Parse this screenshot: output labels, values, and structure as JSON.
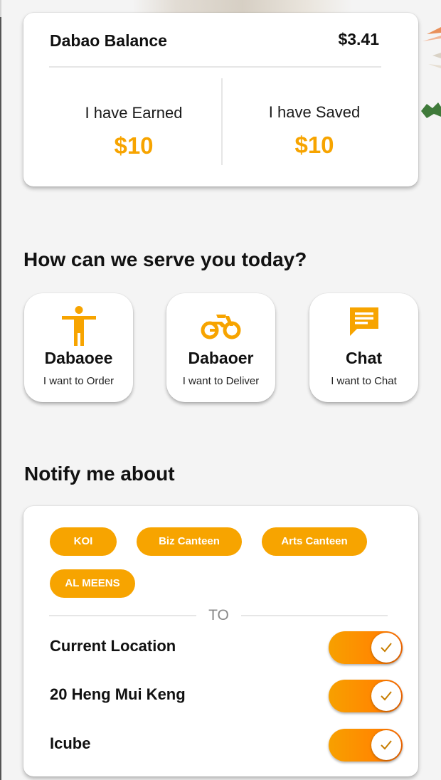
{
  "balance": {
    "label": "Dabao Balance",
    "value": "$3.41",
    "earned_label": "I have Earned",
    "earned_value": "$10",
    "saved_label": "I have Saved",
    "saved_value": "$10"
  },
  "serve": {
    "title": "How can we serve you today?",
    "options": [
      {
        "icon": "person-icon",
        "title": "Dabaoee",
        "subtitle": "I want to Order"
      },
      {
        "icon": "motorcycle-icon",
        "title": "Dabaoer",
        "subtitle": "I want to Deliver"
      },
      {
        "icon": "chat-icon",
        "title": "Chat",
        "subtitle": "I want to Chat"
      }
    ]
  },
  "notify": {
    "title": "Notify me about",
    "places": [
      "KOI",
      "Biz Canteen",
      "Arts Canteen",
      "AL MEENS"
    ],
    "to_label": "TO",
    "locations": [
      {
        "label": "Current Location",
        "enabled": true
      },
      {
        "label": "20 Heng Mui Keng",
        "enabled": true
      },
      {
        "label": "Icube",
        "enabled": true
      }
    ]
  },
  "colors": {
    "accent": "#f7a400",
    "toggle_start": "#f7a000",
    "toggle_end": "#ff6d00",
    "background": "#f4f4f4"
  }
}
